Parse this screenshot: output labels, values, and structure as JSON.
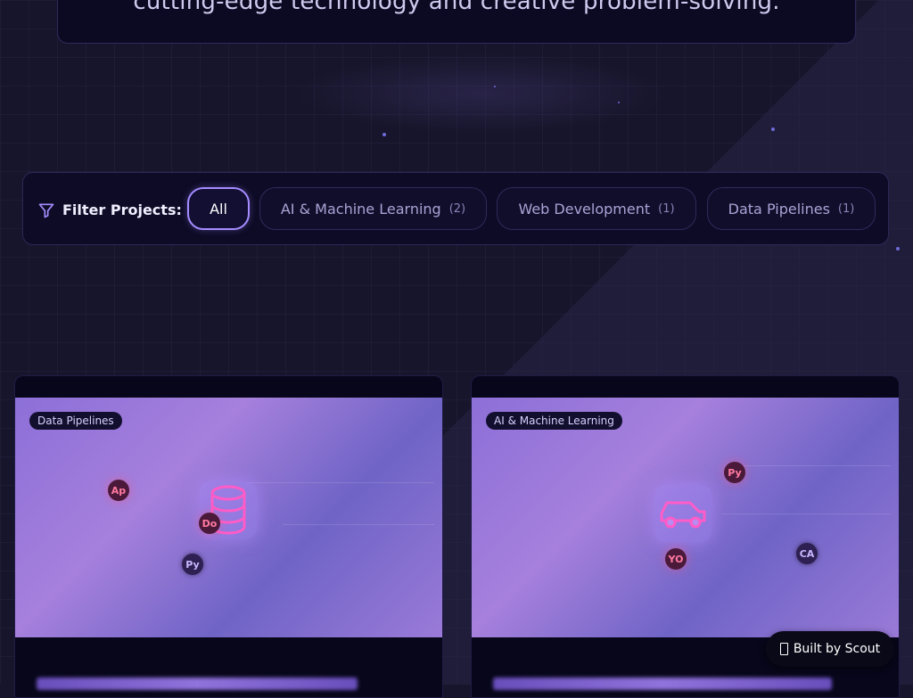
{
  "hero": {
    "text": "cutting-edge technology and creative problem-solving."
  },
  "filter": {
    "label": "Filter Projects:",
    "options": [
      {
        "label": "All",
        "count": "",
        "active": true
      },
      {
        "label": "AI & Machine Learning",
        "count": "(2)",
        "active": false
      },
      {
        "label": "Web Development",
        "count": "(1)",
        "active": false
      },
      {
        "label": "Data Pipelines",
        "count": "(1)",
        "active": false
      }
    ]
  },
  "projects": [
    {
      "category": "Data Pipelines",
      "icon": "database-icon",
      "tech": [
        "Ap",
        "Do",
        "Py"
      ]
    },
    {
      "category": "AI & Machine Learning",
      "icon": "car-icon",
      "tech": [
        "Py",
        "YO",
        "CA"
      ]
    }
  ],
  "footer": {
    "scout_label": "Built by Scout"
  },
  "colors": {
    "background": "#17152b",
    "accent": "#a58cff",
    "card": "#07061a",
    "tech_red": "#ff7aa0"
  }
}
